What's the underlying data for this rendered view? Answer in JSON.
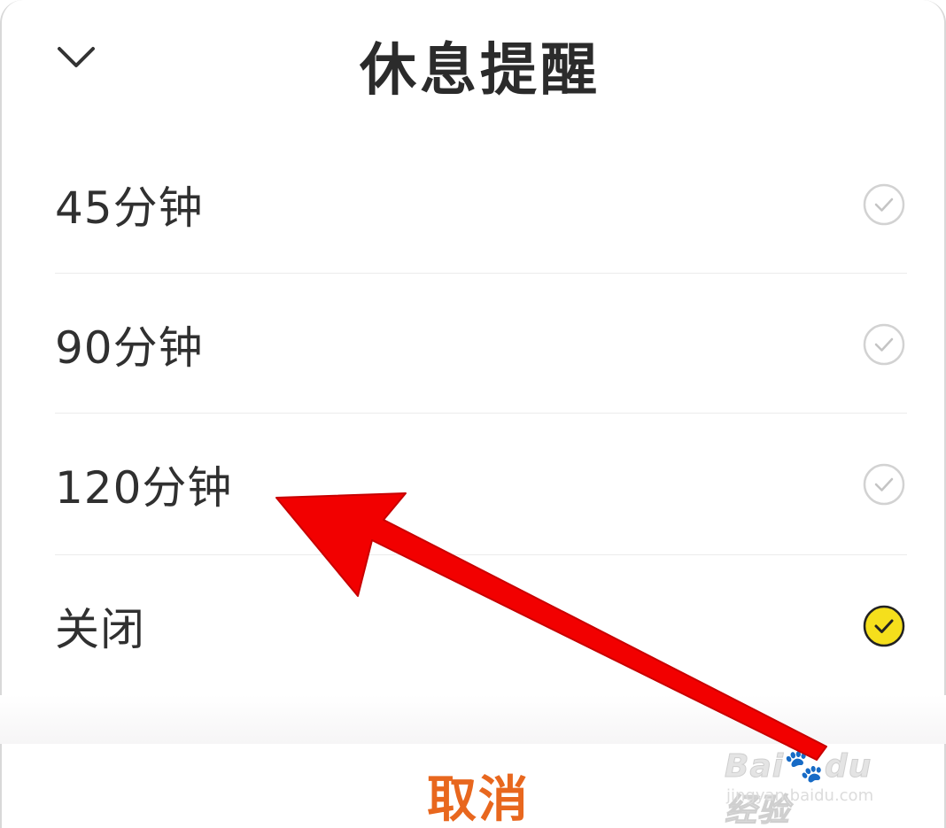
{
  "header": {
    "title": "休息提醒",
    "collapse_icon": "chevron-down-icon"
  },
  "options": [
    {
      "label": "45分钟",
      "selected": false
    },
    {
      "label": "90分钟",
      "selected": false
    },
    {
      "label": "120分钟",
      "selected": false
    },
    {
      "label": "关闭",
      "selected": true
    }
  ],
  "footer": {
    "cancel_label": "取消"
  },
  "colors": {
    "accent": "#e8671e",
    "selected_check_fill": "#f5df1c",
    "unselected_check": "#cfcfcf",
    "annotation_arrow": "#f20000"
  },
  "annotation": {
    "type": "arrow",
    "points_to": "120分钟"
  },
  "watermark": {
    "logo": "Baidu经验",
    "url": "jingyan.baidu.com"
  }
}
